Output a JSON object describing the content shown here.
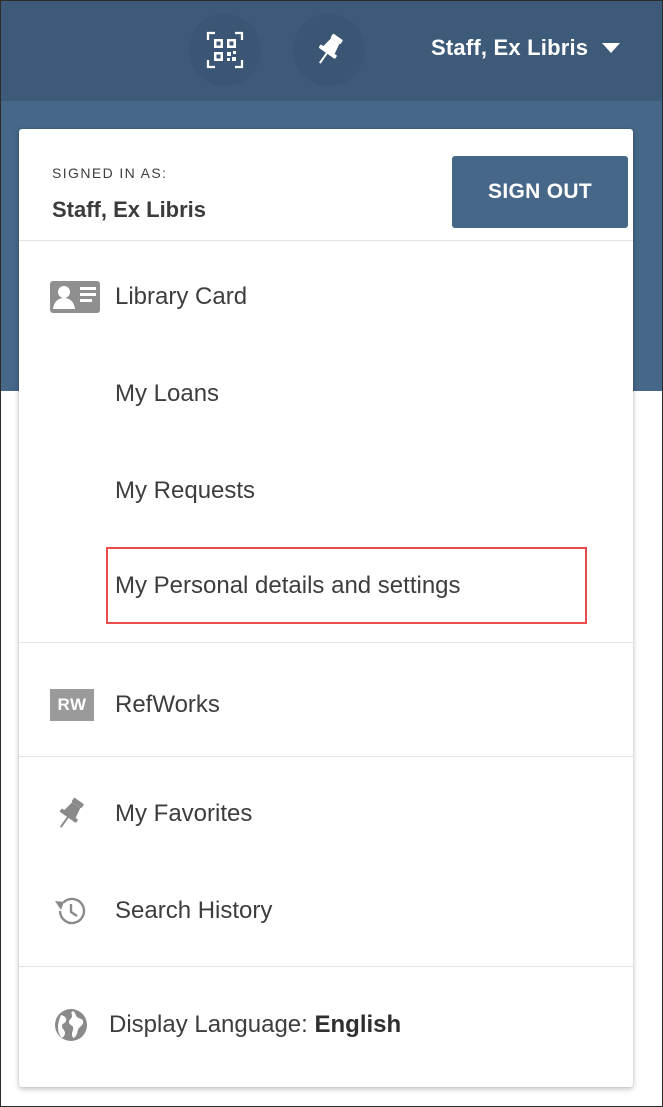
{
  "header": {
    "qr_icon": "qr-code-icon",
    "pin_icon": "pushpin-icon",
    "user_name": "Staff, Ex Libris",
    "caret_icon": "caret-down-icon"
  },
  "menu": {
    "signed_in_label": "SIGNED IN AS:",
    "signed_in_name": "Staff, Ex Libris",
    "sign_out_label": "SIGN OUT",
    "library_card": {
      "icon": "id-card-icon",
      "label": "Library Card"
    },
    "library_items": [
      {
        "label": "My Loans"
      },
      {
        "label": "My Requests"
      },
      {
        "label": "My Personal details and settings",
        "highlighted": true
      }
    ],
    "refworks": {
      "icon_text": "RW",
      "label": "RefWorks"
    },
    "favorites": {
      "icon": "pushpin-icon",
      "label": "My Favorites"
    },
    "search_history": {
      "icon": "history-icon",
      "label": "Search History"
    },
    "display_language": {
      "icon": "globe-icon",
      "label": "Display Language:",
      "value": "English"
    }
  },
  "colors": {
    "header_bg": "#3d5a78",
    "accent": "#466788",
    "highlight_border": "#e84c4c"
  }
}
